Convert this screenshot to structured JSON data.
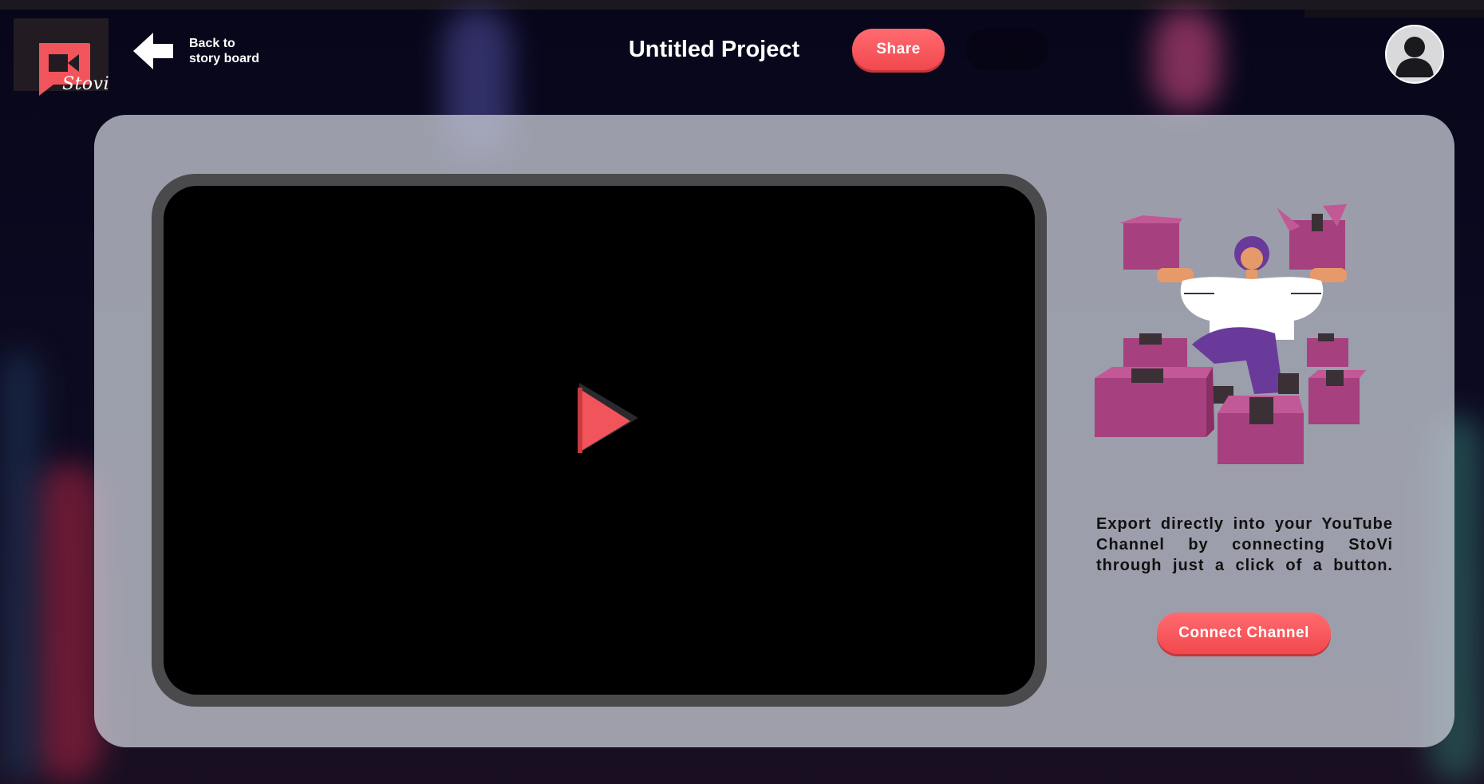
{
  "app": {
    "logo_text": "Stovi",
    "brand_color": "#f2545b"
  },
  "header": {
    "back_label": "Back to\nstory board",
    "project_title": "Untitled Project",
    "share_label": "Share",
    "icons": {
      "back": "arrow-left-icon",
      "profile": "user-avatar-icon"
    }
  },
  "player": {
    "play_icon": "play-icon"
  },
  "export": {
    "description": "Export directly into your YouTube Channel by connecting StoVi through just a click of a button.",
    "connect_label": "Connect Channel"
  },
  "colors": {
    "accent": "#f2545b",
    "panel": "#c4c8d2",
    "frame": "#4a4a4c",
    "background": "#07061a"
  }
}
